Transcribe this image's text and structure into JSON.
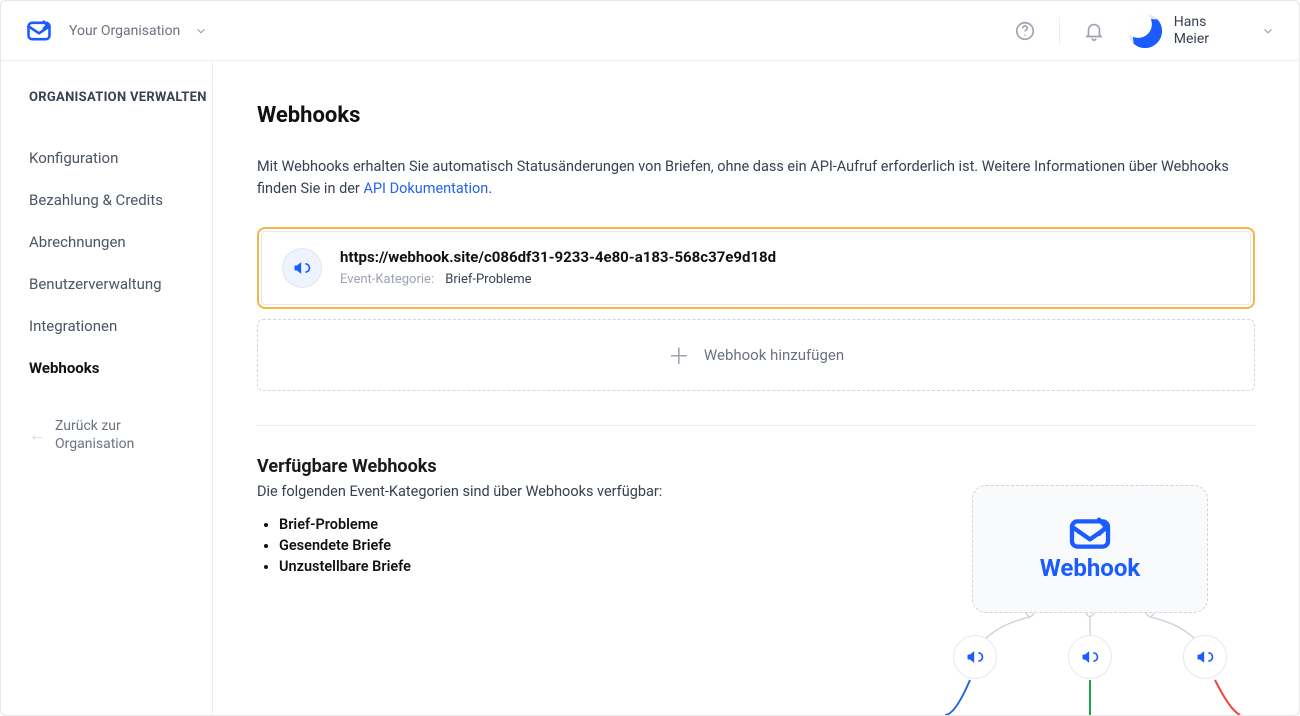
{
  "header": {
    "org_label": "Your Organisation",
    "user_name_line1": "Hans",
    "user_name_line2": "Meier"
  },
  "sidebar": {
    "section_title": "ORGANISATION VERWALTEN",
    "items": [
      {
        "label": "Konfiguration"
      },
      {
        "label": "Bezahlung & Credits"
      },
      {
        "label": "Abrechnungen"
      },
      {
        "label": "Benutzerverwaltung"
      },
      {
        "label": "Integrationen"
      },
      {
        "label": "Webhooks"
      }
    ],
    "back_line1": "Zurück zur",
    "back_line2": "Organisation"
  },
  "page": {
    "title": "Webhooks",
    "lead_before": "Mit Webhooks erhalten Sie automatisch Statusänderungen von Briefen, ohne dass ein API-Aufruf erforderlich ist. Weitere Informationen über Webhooks finden Sie in der ",
    "lead_link": "API Dokumentation",
    "lead_after": "."
  },
  "webhook": {
    "url": "https://webhook.site/c086df31-9233-4e80-a183-568c37e9d18d",
    "category_label": "Event-Kategorie:",
    "category_value": "Brief-Probleme"
  },
  "add_button": "Webhook hinzufügen",
  "available": {
    "title": "Verfügbare Webhooks",
    "desc": "Die folgenden Event-Kategorien sind über Webhooks verfügbar:",
    "items": [
      "Brief-Probleme",
      "Gesendete Briefe",
      "Unzustellbare Briefe"
    ]
  },
  "diagram": {
    "box_label": "Webhook"
  }
}
